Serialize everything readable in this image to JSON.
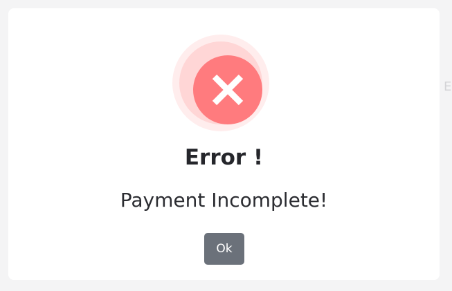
{
  "background": {
    "peek_text": "E"
  },
  "dialog": {
    "icon": "error-x-icon",
    "title": "Error !",
    "message": "Payment Incomplete!",
    "ok_label": "Ok"
  },
  "colors": {
    "icon_core": "#ff7b7e",
    "icon_ring": "#ffd6d6",
    "icon_halo": "#ffeded",
    "button": "#6b717a",
    "title_text": "#25262b"
  }
}
